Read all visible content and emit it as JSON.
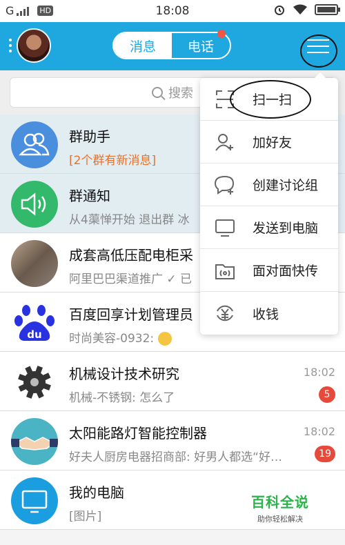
{
  "status_bar": {
    "carrier": "G",
    "hd": "HD",
    "time": "18:08"
  },
  "header": {
    "tab_messages": "消息",
    "tab_calls": "电话"
  },
  "search": {
    "placeholder": "搜索"
  },
  "chats": [
    {
      "title": "群助手",
      "subtitle": "[2个群有新消息]",
      "time": "",
      "badge": ""
    },
    {
      "title": "群通知",
      "subtitle": "从4蕖惮开始 退出群 冰",
      "time": "",
      "badge": ""
    },
    {
      "title": "成套高低压配电柜采",
      "subtitle": "阿里巴巴渠道推广 ✓ 已",
      "time": "",
      "badge": ""
    },
    {
      "title": "百度回享计划管理员",
      "subtitle": "时尚美容-0932: ",
      "time": "",
      "badge": ""
    },
    {
      "title": "机械设计技术研究",
      "subtitle": "机械-不锈钢: 怎么了",
      "time": "18:02",
      "badge": "5"
    },
    {
      "title": "太阳能路灯智能控制器",
      "subtitle": "好夫人厨房电器招商部: 好男人都选“好…",
      "time": "18:02",
      "badge": "19"
    },
    {
      "title": "我的电脑",
      "subtitle": "[图片]",
      "time": "",
      "badge": ""
    }
  ],
  "popup_menu": [
    {
      "label": "扫一扫",
      "icon": "scan-icon"
    },
    {
      "label": "加好友",
      "icon": "add-friend-icon"
    },
    {
      "label": "创建讨论组",
      "icon": "chat-bubble-icon"
    },
    {
      "label": "发送到电脑",
      "icon": "monitor-icon"
    },
    {
      "label": "面对面快传",
      "icon": "folder-transfer-icon"
    },
    {
      "label": "收钱",
      "icon": "yuan-icon"
    }
  ],
  "watermark": {
    "main": "百科全说",
    "sub": "助你轻松解决"
  },
  "colors": {
    "header": "#1fa8e0",
    "badge": "#e64a3b",
    "orange_text": "#e8722c",
    "watermark_green": "#2bb24c"
  }
}
